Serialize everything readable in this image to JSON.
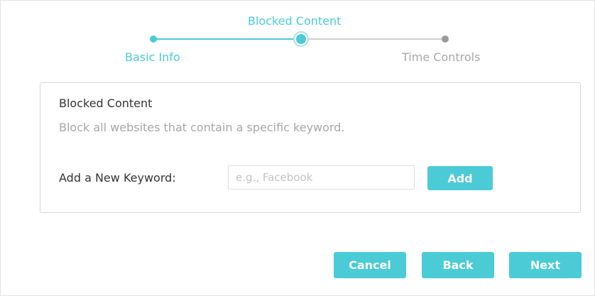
{
  "stepper": {
    "steps": [
      {
        "label": "Basic Info",
        "state": "done"
      },
      {
        "label": "Blocked Content",
        "state": "current"
      },
      {
        "label": "Time Controls",
        "state": "todo"
      }
    ]
  },
  "colors": {
    "accent": "#4acbd6",
    "inactive": "#a8a8a8",
    "text": "#333333"
  },
  "card": {
    "title": "Blocked Content",
    "description": "Block all websites that contain a specific keyword.",
    "keyword_label": "Add a New Keyword:",
    "keyword_value": "",
    "keyword_placeholder": "e.g., Facebook",
    "add_label": "Add"
  },
  "footer": {
    "cancel_label": "Cancel",
    "back_label": "Back",
    "next_label": "Next"
  }
}
